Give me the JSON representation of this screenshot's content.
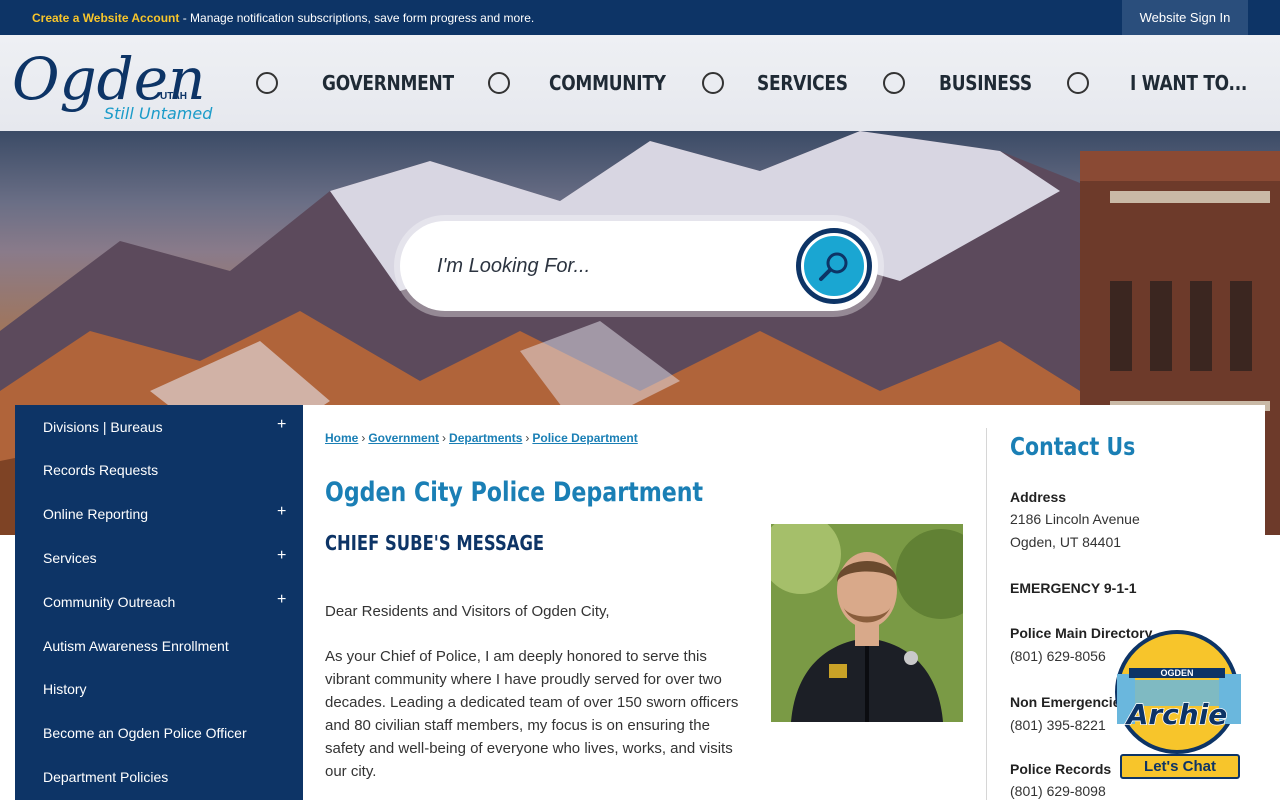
{
  "topbar": {
    "create_account": "Create a Website Account",
    "message": " - Manage notification subscriptions, save form progress and more.",
    "sign_in": "Website Sign In"
  },
  "logo": {
    "name": "Ogden",
    "state": "UTAH",
    "tagline": "Still Untamed"
  },
  "nav": [
    {
      "label": "GOVERNMENT"
    },
    {
      "label": "COMMUNITY"
    },
    {
      "label": "SERVICES"
    },
    {
      "label": "BUSINESS"
    },
    {
      "label": "I WANT TO..."
    }
  ],
  "search": {
    "placeholder": "I'm Looking For..."
  },
  "sidebar": {
    "items": [
      {
        "label": "Divisions | Bureaus",
        "expandable": true
      },
      {
        "label": "Records Requests",
        "expandable": false
      },
      {
        "label": "Online Reporting",
        "expandable": true
      },
      {
        "label": "Services",
        "expandable": true
      },
      {
        "label": "Community Outreach",
        "expandable": true
      },
      {
        "label": "Autism Awareness Enrollment",
        "expandable": false
      },
      {
        "label": "History",
        "expandable": false
      },
      {
        "label": "Become an Ogden Police Officer",
        "expandable": false
      },
      {
        "label": "Department Policies",
        "expandable": false
      }
    ],
    "expand_symbol": "+"
  },
  "breadcrumb": {
    "items": [
      "Home",
      "Government",
      "Departments",
      "Police Department"
    ],
    "separator": "›"
  },
  "main": {
    "title": "Ogden City Police Department",
    "subtitle": "CHIEF SUBE'S MESSAGE",
    "greeting": "Dear Residents and Visitors of Ogden City,",
    "paragraph": "As your Chief of Police, I am deeply honored to serve this vibrant community where I have proudly served for over two decades. Leading a dedicated team of over 150 sworn officers and 80 civilian staff members, my focus is on ensuring the safety and well-being of everyone who lives, works, and visits our city."
  },
  "contact": {
    "title": "Contact Us",
    "address_label": "Address",
    "address_line1": "2186 Lincoln Avenue",
    "address_line2": "Ogden, UT 84401",
    "emergency": "EMERGENCY 9-1-1",
    "main_label": "Police Main Directory",
    "main_phone": "(801) 629-8056",
    "non_emergency_label": "Non Emergencies",
    "non_emergency_phone": "(801) 395-8221",
    "records_label": "Police Records",
    "records_phone": "(801) 629-8098"
  },
  "chat": {
    "badge_top": "OGDEN",
    "badge_name": "Archie",
    "button": "Let's Chat"
  },
  "colors": {
    "navy": "#0d3466",
    "accent_blue": "#1a7fb5",
    "yellow": "#f7c52b",
    "search_blue": "#1aa6d2"
  }
}
